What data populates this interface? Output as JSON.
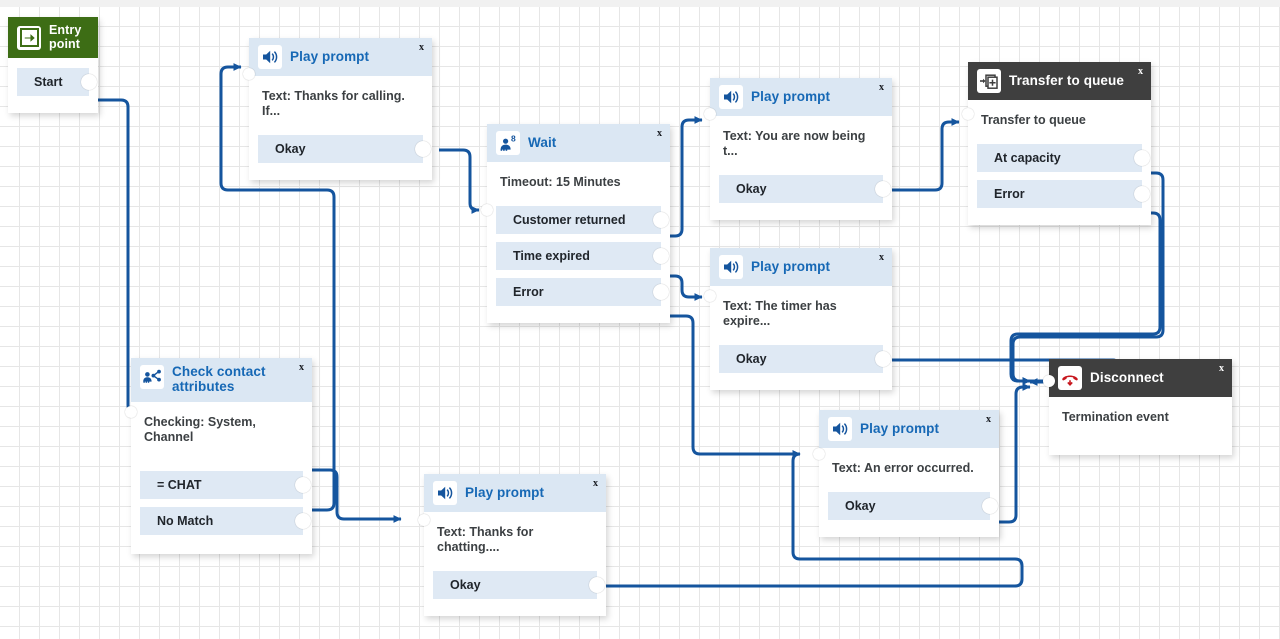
{
  "app": {
    "name": "contact-flow-designer",
    "canvas_background": "#ffffff",
    "grid_color": "#e6e6e6",
    "wire_color": "#15559e",
    "accent_blue": "#1668b5",
    "header_blue": "#dbe7f3",
    "header_dark": "#3f3f3f",
    "header_green": "#3d6d15",
    "branch_bg": "#dfe9f4",
    "close_label": "x"
  },
  "nodes": [
    {
      "id": "entry-point",
      "title": "Entry point",
      "icon": "entry-arrow-icon",
      "header_style": "green",
      "has_close": false,
      "description": null,
      "branches": [
        {
          "label": "Start"
        }
      ]
    },
    {
      "id": "play-prompt-thanks-calling",
      "title": "Play prompt",
      "icon": "speaker-icon",
      "header_style": "blue",
      "has_close": true,
      "description": "Text: Thanks for calling. If...",
      "branches": [
        {
          "label": "Okay"
        }
      ]
    },
    {
      "id": "wait",
      "title": "Wait",
      "icon": "customer-wait-icon",
      "header_style": "blue",
      "has_close": true,
      "description": "Timeout: 15 Minutes",
      "branches": [
        {
          "label": "Customer returned"
        },
        {
          "label": "Time expired"
        },
        {
          "label": "Error"
        }
      ]
    },
    {
      "id": "play-prompt-being-transferred",
      "title": "Play prompt",
      "icon": "speaker-icon",
      "header_style": "blue",
      "has_close": true,
      "description": "Text: You are now being t...",
      "branches": [
        {
          "label": "Okay"
        }
      ]
    },
    {
      "id": "play-prompt-timer-expired",
      "title": "Play prompt",
      "icon": "speaker-icon",
      "header_style": "blue",
      "has_close": true,
      "description": "Text: The timer has expire...",
      "branches": [
        {
          "label": "Okay"
        }
      ]
    },
    {
      "id": "transfer-to-queue",
      "title": "Transfer to queue",
      "icon": "transfer-queue-icon",
      "header_style": "dark",
      "has_close": true,
      "description": "Transfer to queue",
      "branches": [
        {
          "label": "At capacity"
        },
        {
          "label": "Error"
        }
      ]
    },
    {
      "id": "disconnect",
      "title": "Disconnect",
      "icon": "hangup-phone-icon",
      "header_style": "dark",
      "has_close": true,
      "description": "Termination event",
      "branches": []
    },
    {
      "id": "check-contact-attributes",
      "title": "Check contact attributes",
      "icon": "branch-attributes-icon",
      "header_style": "blue",
      "has_close": true,
      "description": "Checking: System, Channel",
      "branches": [
        {
          "label": "= CHAT"
        },
        {
          "label": "No Match"
        }
      ]
    },
    {
      "id": "play-prompt-thanks-chatting",
      "title": "Play prompt",
      "icon": "speaker-icon",
      "header_style": "blue",
      "has_close": true,
      "description": "Text: Thanks for chatting....",
      "branches": [
        {
          "label": "Okay"
        }
      ]
    },
    {
      "id": "play-prompt-error-occurred",
      "title": "Play prompt",
      "icon": "speaker-icon",
      "header_style": "blue",
      "has_close": true,
      "description": "Text: An error occurred.",
      "branches": [
        {
          "label": "Okay"
        }
      ]
    }
  ]
}
